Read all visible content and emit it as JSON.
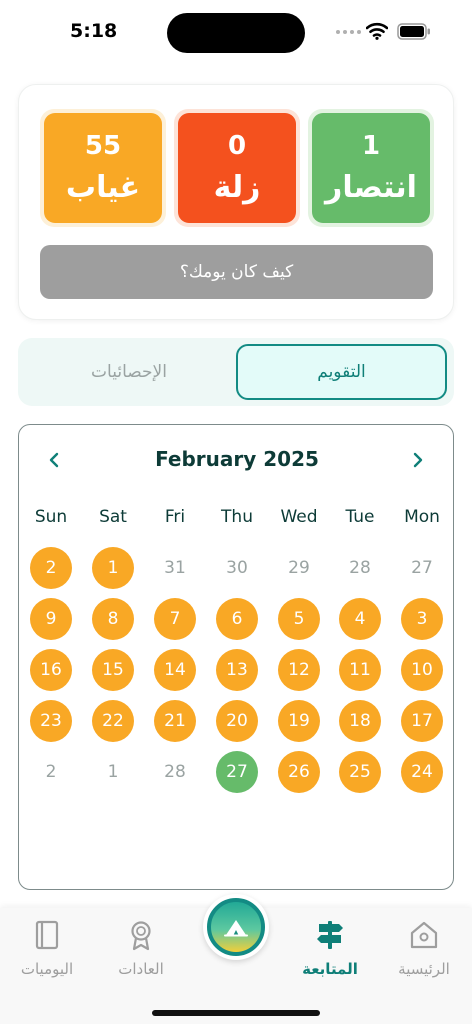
{
  "status_bar": {
    "time": "5:18"
  },
  "summary": {
    "absent": {
      "count": "55",
      "label": "غياب",
      "color": "#f9a825"
    },
    "slip": {
      "count": "0",
      "label": "زلة",
      "color": "#f4511e"
    },
    "victory": {
      "count": "1",
      "label": "انتصار",
      "color": "#66bb6a"
    },
    "day_prompt": "كيف كان يومك؟"
  },
  "tabs": {
    "statistics": "الإحصائيات",
    "calendar": "التقويم",
    "active": "calendar"
  },
  "calendar": {
    "month_title": "February 2025",
    "prev_icon": "chevron-left-icon",
    "next_icon": "chevron-right-icon",
    "weekdays": [
      "Sun",
      "Sat",
      "Fri",
      "Thu",
      "Wed",
      "Tue",
      "Mon"
    ],
    "weeks": [
      [
        {
          "d": "2",
          "s": "absent"
        },
        {
          "d": "1",
          "s": "absent"
        },
        {
          "d": "31",
          "s": "none"
        },
        {
          "d": "30",
          "s": "none"
        },
        {
          "d": "29",
          "s": "none"
        },
        {
          "d": "28",
          "s": "none"
        },
        {
          "d": "27",
          "s": "none"
        }
      ],
      [
        {
          "d": "9",
          "s": "absent"
        },
        {
          "d": "8",
          "s": "absent"
        },
        {
          "d": "7",
          "s": "absent"
        },
        {
          "d": "6",
          "s": "absent"
        },
        {
          "d": "5",
          "s": "absent"
        },
        {
          "d": "4",
          "s": "absent"
        },
        {
          "d": "3",
          "s": "absent"
        }
      ],
      [
        {
          "d": "16",
          "s": "absent"
        },
        {
          "d": "15",
          "s": "absent"
        },
        {
          "d": "14",
          "s": "absent"
        },
        {
          "d": "13",
          "s": "absent"
        },
        {
          "d": "12",
          "s": "absent"
        },
        {
          "d": "11",
          "s": "absent"
        },
        {
          "d": "10",
          "s": "absent"
        }
      ],
      [
        {
          "d": "23",
          "s": "absent"
        },
        {
          "d": "22",
          "s": "absent"
        },
        {
          "d": "21",
          "s": "absent"
        },
        {
          "d": "20",
          "s": "absent"
        },
        {
          "d": "19",
          "s": "absent"
        },
        {
          "d": "18",
          "s": "absent"
        },
        {
          "d": "17",
          "s": "absent"
        }
      ],
      [
        {
          "d": "2",
          "s": "none"
        },
        {
          "d": "1",
          "s": "none"
        },
        {
          "d": "28",
          "s": "none"
        },
        {
          "d": "27",
          "s": "victory"
        },
        {
          "d": "26",
          "s": "absent"
        },
        {
          "d": "25",
          "s": "absent"
        },
        {
          "d": "24",
          "s": "absent"
        }
      ]
    ]
  },
  "bottom_nav": {
    "diaries": {
      "label": "اليوميات",
      "icon": "book-icon"
    },
    "habits": {
      "label": "العادات",
      "icon": "award-ribbon-icon"
    },
    "center": {
      "icon": "tent-icon"
    },
    "tracking": {
      "label": "المتابعة",
      "icon": "signpost-icon"
    },
    "home": {
      "label": "الرئيسية",
      "icon": "house-icon"
    },
    "active": "tracking"
  },
  "colors": {
    "accent": "#138b84",
    "dark_text": "#0d3b37",
    "muted": "#9aa3a2"
  }
}
